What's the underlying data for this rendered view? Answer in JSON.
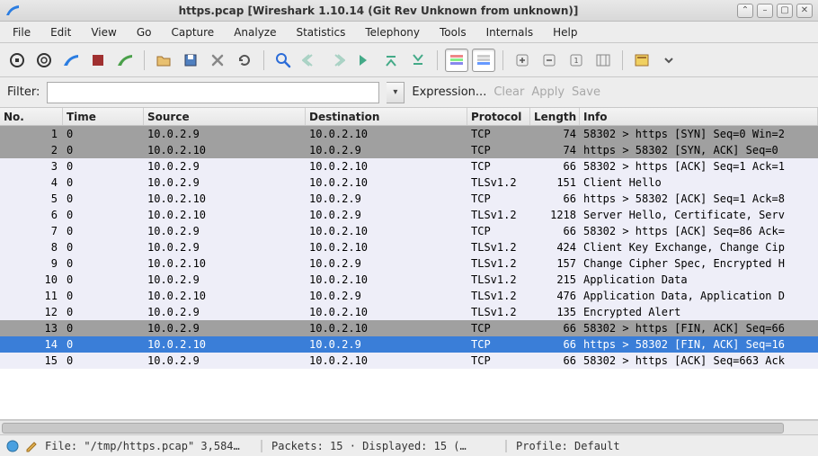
{
  "window": {
    "title": "https.pcap   [Wireshark 1.10.14  (Git Rev Unknown from unknown)]"
  },
  "menu": [
    "File",
    "Edit",
    "View",
    "Go",
    "Capture",
    "Analyze",
    "Statistics",
    "Telephony",
    "Tools",
    "Internals",
    "Help"
  ],
  "filter": {
    "label": "Filter:",
    "value": "",
    "expression": "Expression...",
    "clear": "Clear",
    "apply": "Apply",
    "save": "Save"
  },
  "columns": [
    "No.",
    "Time",
    "Source",
    "Destination",
    "Protocol",
    "Length",
    "Info"
  ],
  "packets": [
    {
      "no": "1",
      "time": "0",
      "src": "10.0.2.9",
      "dst": "10.0.2.10",
      "proto": "TCP",
      "len": "74",
      "info": "58302 > https [SYN] Seq=0 Win=2",
      "cls": "gray"
    },
    {
      "no": "2",
      "time": "0",
      "src": "10.0.2.10",
      "dst": "10.0.2.9",
      "proto": "TCP",
      "len": "74",
      "info": "https > 58302 [SYN, ACK] Seq=0",
      "cls": "gray"
    },
    {
      "no": "3",
      "time": "0",
      "src": "10.0.2.9",
      "dst": "10.0.2.10",
      "proto": "TCP",
      "len": "66",
      "info": "58302 > https [ACK] Seq=1 Ack=1",
      "cls": "light"
    },
    {
      "no": "4",
      "time": "0",
      "src": "10.0.2.9",
      "dst": "10.0.2.10",
      "proto": "TLSv1.2",
      "len": "151",
      "info": "Client Hello",
      "cls": "light"
    },
    {
      "no": "5",
      "time": "0",
      "src": "10.0.2.10",
      "dst": "10.0.2.9",
      "proto": "TCP",
      "len": "66",
      "info": "https > 58302 [ACK] Seq=1 Ack=8",
      "cls": "light"
    },
    {
      "no": "6",
      "time": "0",
      "src": "10.0.2.10",
      "dst": "10.0.2.9",
      "proto": "TLSv1.2",
      "len": "1218",
      "info": "Server Hello, Certificate, Serv",
      "cls": "light"
    },
    {
      "no": "7",
      "time": "0",
      "src": "10.0.2.9",
      "dst": "10.0.2.10",
      "proto": "TCP",
      "len": "66",
      "info": "58302 > https [ACK] Seq=86 Ack=",
      "cls": "light"
    },
    {
      "no": "8",
      "time": "0",
      "src": "10.0.2.9",
      "dst": "10.0.2.10",
      "proto": "TLSv1.2",
      "len": "424",
      "info": "Client Key Exchange, Change Cip",
      "cls": "light"
    },
    {
      "no": "9",
      "time": "0",
      "src": "10.0.2.10",
      "dst": "10.0.2.9",
      "proto": "TLSv1.2",
      "len": "157",
      "info": "Change Cipher Spec, Encrypted H",
      "cls": "light"
    },
    {
      "no": "10",
      "time": "0",
      "src": "10.0.2.9",
      "dst": "10.0.2.10",
      "proto": "TLSv1.2",
      "len": "215",
      "info": "Application Data",
      "cls": "light"
    },
    {
      "no": "11",
      "time": "0",
      "src": "10.0.2.10",
      "dst": "10.0.2.9",
      "proto": "TLSv1.2",
      "len": "476",
      "info": "Application Data, Application D",
      "cls": "light"
    },
    {
      "no": "12",
      "time": "0",
      "src": "10.0.2.9",
      "dst": "10.0.2.10",
      "proto": "TLSv1.2",
      "len": "135",
      "info": "Encrypted Alert",
      "cls": "light"
    },
    {
      "no": "13",
      "time": "0",
      "src": "10.0.2.9",
      "dst": "10.0.2.10",
      "proto": "TCP",
      "len": "66",
      "info": "58302 > https [FIN, ACK] Seq=66",
      "cls": "gray"
    },
    {
      "no": "14",
      "time": "0",
      "src": "10.0.2.10",
      "dst": "10.0.2.9",
      "proto": "TCP",
      "len": "66",
      "info": "https > 58302 [FIN, ACK] Seq=16",
      "cls": "sel"
    },
    {
      "no": "15",
      "time": "0",
      "src": "10.0.2.9",
      "dst": "10.0.2.10",
      "proto": "TCP",
      "len": "66",
      "info": "58302 > https [ACK] Seq=663 Ack",
      "cls": "light"
    }
  ],
  "status": {
    "file": "File: \"/tmp/https.pcap\" 3,584…",
    "packets": "Packets: 15 · Displayed: 15 (…",
    "profile": "Profile: Default"
  }
}
